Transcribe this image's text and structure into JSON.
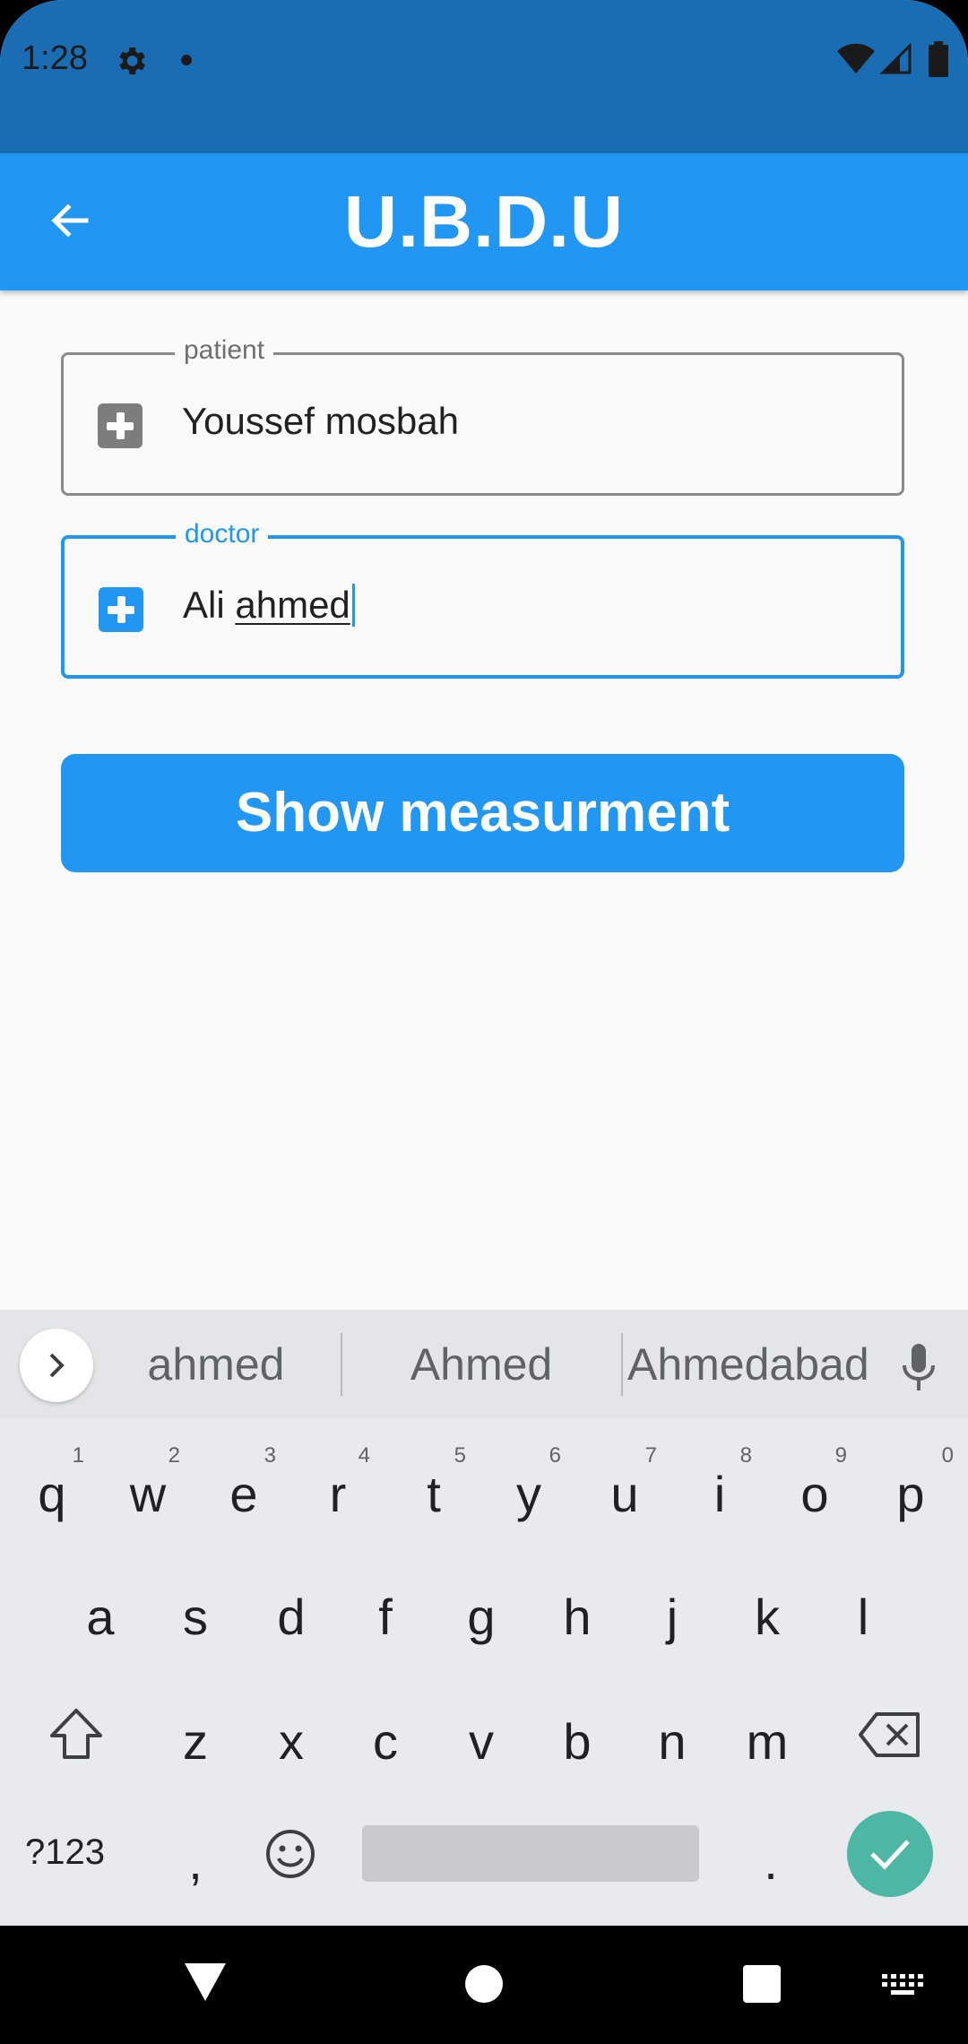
{
  "status_bar": {
    "time": "1:28",
    "icons": [
      "settings-icon",
      "notification-dot",
      "wifi-icon",
      "signal-icon",
      "battery-icon"
    ]
  },
  "app_bar": {
    "title": "U.B.D.U",
    "back_icon": "arrow-left-icon",
    "background": "#2196f3"
  },
  "form": {
    "patient": {
      "label": "patient",
      "value": "Youssef mosbah",
      "icon": "medical-cross-icon"
    },
    "doctor": {
      "label": "doctor",
      "value_first": "Ali",
      "value_underlined": "ahmed",
      "icon": "medical-cross-icon",
      "focused": true
    },
    "submit_label": "Show measurment"
  },
  "keyboard": {
    "suggestions": [
      "ahmed",
      "Ahmed",
      "Ahmedabad"
    ],
    "row1": [
      {
        "key": "q",
        "hint": "1"
      },
      {
        "key": "w",
        "hint": "2"
      },
      {
        "key": "e",
        "hint": "3"
      },
      {
        "key": "r",
        "hint": "4"
      },
      {
        "key": "t",
        "hint": "5"
      },
      {
        "key": "y",
        "hint": "6"
      },
      {
        "key": "u",
        "hint": "7"
      },
      {
        "key": "i",
        "hint": "8"
      },
      {
        "key": "o",
        "hint": "9"
      },
      {
        "key": "p",
        "hint": "0"
      }
    ],
    "row2": [
      "a",
      "s",
      "d",
      "f",
      "g",
      "h",
      "j",
      "k",
      "l"
    ],
    "row3": [
      "z",
      "x",
      "c",
      "v",
      "b",
      "n",
      "m"
    ],
    "bottom": {
      "symbols_label": "?123",
      "comma": ",",
      "period": "."
    },
    "enter_color": "#4db6a5"
  },
  "nav_bar": {
    "icons": [
      "back-triangle-icon",
      "home-circle-icon",
      "recents-square-icon",
      "keyboard-switch-icon"
    ]
  }
}
